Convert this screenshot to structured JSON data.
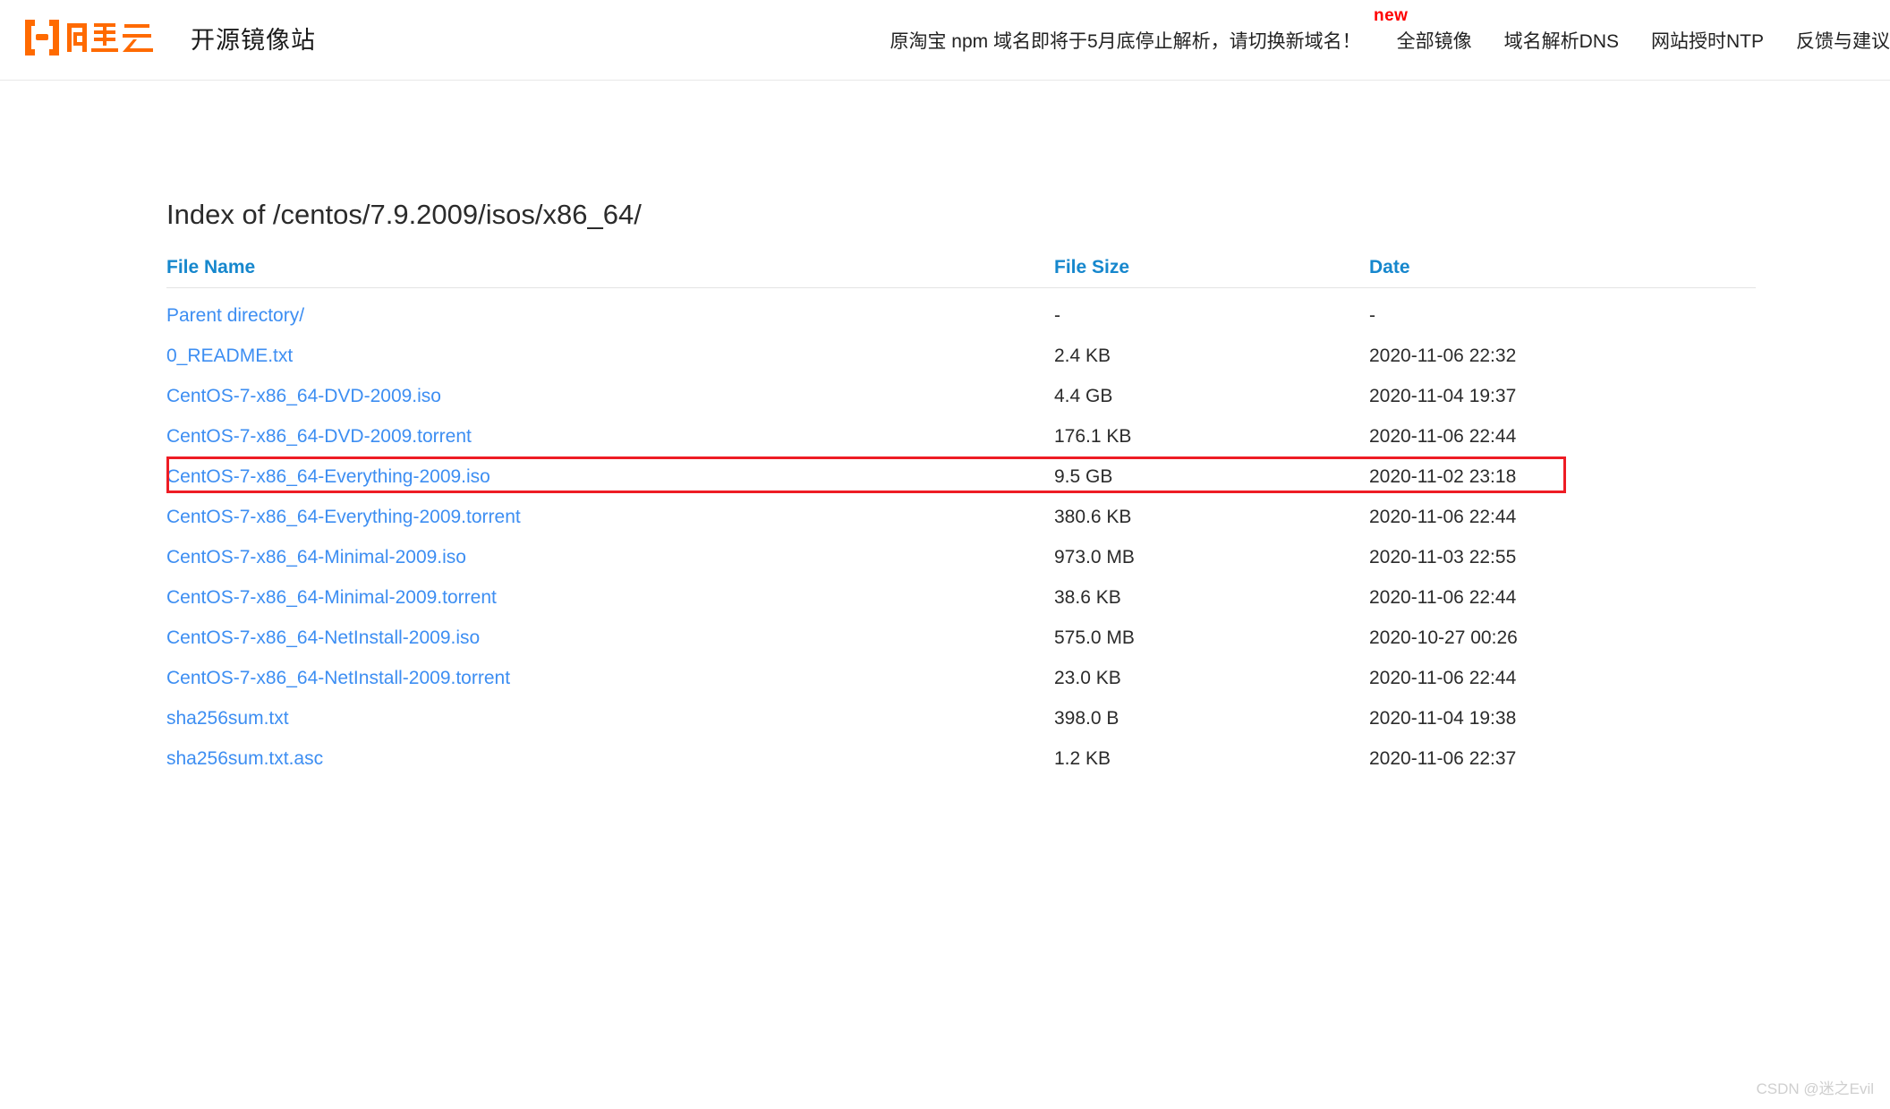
{
  "header": {
    "logo_icon": "aliyun-logo-icon",
    "logo_color": "#ff6a00",
    "site_name": "开源镜像站",
    "notice": "原淘宝 npm 域名即将于5月底停止解析，请切换新域名！",
    "new_badge": "new",
    "nav": [
      {
        "label": "全部镜像"
      },
      {
        "label": "域名解析DNS"
      },
      {
        "label": "网站授时NTP"
      },
      {
        "label": "反馈与建议"
      }
    ]
  },
  "main": {
    "title": "Index of /centos/7.9.2009/isos/x86_64/",
    "columns": {
      "name": "File Name",
      "size": "File Size",
      "date": "Date"
    },
    "accent_color": "#1687cd",
    "link_color": "#3d8ef2",
    "highlight_color": "#ee1c24",
    "rows": [
      {
        "name": "Parent directory/",
        "size": "-",
        "date": "-"
      },
      {
        "name": "0_README.txt",
        "size": "2.4 KB",
        "date": "2020-11-06 22:32"
      },
      {
        "name": "CentOS-7-x86_64-DVD-2009.iso",
        "size": "4.4 GB",
        "date": "2020-11-04 19:37"
      },
      {
        "name": "CentOS-7-x86_64-DVD-2009.torrent",
        "size": "176.1 KB",
        "date": "2020-11-06 22:44"
      },
      {
        "name": "CentOS-7-x86_64-Everything-2009.iso",
        "size": "9.5 GB",
        "date": "2020-11-02 23:18"
      },
      {
        "name": "CentOS-7-x86_64-Everything-2009.torrent",
        "size": "380.6 KB",
        "date": "2020-11-06 22:44"
      },
      {
        "name": "CentOS-7-x86_64-Minimal-2009.iso",
        "size": "973.0 MB",
        "date": "2020-11-03 22:55"
      },
      {
        "name": "CentOS-7-x86_64-Minimal-2009.torrent",
        "size": "38.6 KB",
        "date": "2020-11-06 22:44"
      },
      {
        "name": "CentOS-7-x86_64-NetInstall-2009.iso",
        "size": "575.0 MB",
        "date": "2020-10-27 00:26"
      },
      {
        "name": "CentOS-7-x86_64-NetInstall-2009.torrent",
        "size": "23.0 KB",
        "date": "2020-11-06 22:44"
      },
      {
        "name": "sha256sum.txt",
        "size": "398.0 B",
        "date": "2020-11-04 19:38"
      },
      {
        "name": "sha256sum.txt.asc",
        "size": "1.2 KB",
        "date": "2020-11-06 22:37"
      }
    ],
    "highlighted_row_index": 2
  },
  "watermark": {
    "text": "CSDN @迷之Evil"
  }
}
